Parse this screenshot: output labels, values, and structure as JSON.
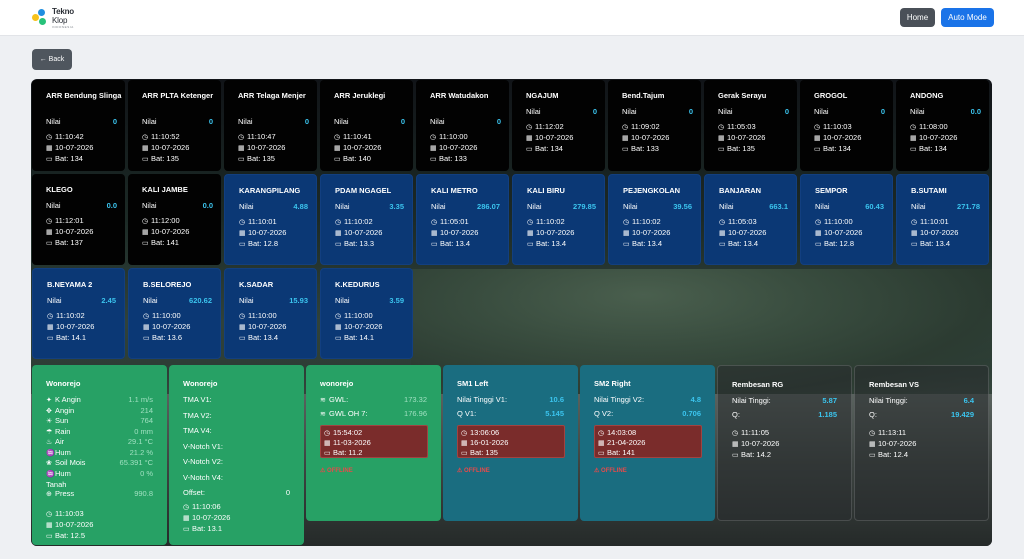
{
  "header": {
    "logo_line1": "Tekno",
    "logo_line2": "Klop",
    "logo_sub": "INDONESIA",
    "home_label": "Home",
    "auto_label": "Auto Mode"
  },
  "back_label": "← Back",
  "stations": [
    {
      "name": "ARR Bendung Slinga",
      "label": "Nilai",
      "value": "0",
      "time": "11:10:42",
      "date": "10-07-2026",
      "bat": "Bat: 134"
    },
    {
      "name": "ARR PLTA Ketenger",
      "label": "Nilai",
      "value": "0",
      "time": "11:10:52",
      "date": "10-07-2026",
      "bat": "Bat: 135"
    },
    {
      "name": "ARR Telaga Menjer",
      "label": "Nilai",
      "value": "0",
      "time": "11:10:47",
      "date": "10-07-2026",
      "bat": "Bat: 135"
    },
    {
      "name": "ARR Jeruklegi",
      "label": "Nilai",
      "value": "0",
      "time": "11:10:41",
      "date": "10-07-2026",
      "bat": "Bat: 140"
    },
    {
      "name": "ARR Watudakon",
      "label": "Nilai",
      "value": "0",
      "time": "11:10:00",
      "date": "10-07-2026",
      "bat": "Bat: 133"
    },
    {
      "name": "NGAJUM",
      "label": "Nilai",
      "value": "0",
      "time": "11:12:02",
      "date": "10-07-2026",
      "bat": "Bat: 134"
    },
    {
      "name": "Bend.Tajum",
      "label": "Nilai",
      "value": "0",
      "time": "11:09:02",
      "date": "10-07-2026",
      "bat": "Bat: 133"
    },
    {
      "name": "Gerak Serayu",
      "label": "Nilai",
      "value": "0",
      "time": "11:05:03",
      "date": "10-07-2026",
      "bat": "Bat: 135"
    },
    {
      "name": "GROGOL",
      "label": "Nilai",
      "value": "0",
      "time": "11:10:03",
      "date": "10-07-2026",
      "bat": "Bat: 134"
    },
    {
      "name": "ANDONG",
      "label": "Nilai",
      "value": "0.0",
      "time": "11:08:00",
      "date": "10-07-2026",
      "bat": "Bat: 134"
    },
    {
      "name": "KLEGO",
      "label": "Nilai",
      "value": "0.0",
      "time": "11:12:01",
      "date": "10-07-2026",
      "bat": "Bat: 137"
    },
    {
      "name": "KALI JAMBE",
      "label": "Nilai",
      "value": "0.0",
      "time": "11:12:00",
      "date": "10-07-2026",
      "bat": "Bat: 141"
    },
    {
      "name": "KARANGPILANG",
      "label": "Nilai",
      "value": "4.88",
      "time": "11:10:01",
      "date": "10-07-2026",
      "bat": "Bat: 12.8"
    },
    {
      "name": "PDAM NGAGEL",
      "label": "Nilai",
      "value": "3.35",
      "time": "11:10:02",
      "date": "10-07-2026",
      "bat": "Bat: 13.3"
    },
    {
      "name": "KALI METRO",
      "label": "Nilai",
      "value": "286.07",
      "time": "11:05:01",
      "date": "10-07-2026",
      "bat": "Bat: 13.4"
    },
    {
      "name": "KALI BIRU",
      "label": "Nilai",
      "value": "279.85",
      "time": "11:10:02",
      "date": "10-07-2026",
      "bat": "Bat: 13.4"
    },
    {
      "name": "PEJENGKOLAN",
      "label": "Nilai",
      "value": "39.56",
      "time": "11:10:02",
      "date": "10-07-2026",
      "bat": "Bat: 13.4"
    },
    {
      "name": "BANJARAN",
      "label": "Nilai",
      "value": "663.1",
      "time": "11:05:03",
      "date": "10-07-2026",
      "bat": "Bat: 13.4"
    },
    {
      "name": "SEMPOR",
      "label": "Nilai",
      "value": "60.43",
      "time": "11:10:00",
      "date": "10-07-2026",
      "bat": "Bat: 12.8"
    },
    {
      "name": "B.SUTAMI",
      "label": "Nilai",
      "value": "271.78",
      "time": "11:10:01",
      "date": "10-07-2026",
      "bat": "Bat: 13.4"
    },
    {
      "name": "B.NEYAMA 2",
      "label": "Nilai",
      "value": "2.45",
      "time": "11:10:02",
      "date": "10-07-2026",
      "bat": "Bat: 14.1"
    },
    {
      "name": "B.SELOREJO",
      "label": "Nilai",
      "value": "620.62",
      "time": "11:10:00",
      "date": "10-07-2026",
      "bat": "Bat: 13.6"
    },
    {
      "name": "K.SADAR",
      "label": "Nilai",
      "value": "15.93",
      "time": "11:10:00",
      "date": "10-07-2026",
      "bat": "Bat: 13.4"
    },
    {
      "name": "K.KEDURUS",
      "label": "Nilai",
      "value": "3.59",
      "time": "11:10:00",
      "date": "10-07-2026",
      "bat": "Bat: 14.1"
    }
  ],
  "weather": {
    "name": "Wonorejo",
    "rows": [
      {
        "label": "K Angin",
        "value": "1.1 m/s"
      },
      {
        "label": "Angin",
        "value": "214"
      },
      {
        "label": "Sun",
        "value": "764"
      },
      {
        "label": "Rain",
        "value": "0 mm"
      },
      {
        "label": "Air",
        "value": "29.1 °C"
      },
      {
        "label": "Hum",
        "value": "21.2 %"
      },
      {
        "label": "Soil Mois",
        "value": "65.391 °C"
      },
      {
        "label": "Hum Tanah",
        "value": "0 %"
      },
      {
        "label": "Press",
        "value": "990.8"
      }
    ],
    "time": "11:10:03",
    "date": "10-07-2026",
    "bat": "Bat: 12.5"
  },
  "tma": {
    "name": "Wonorejo",
    "rows": [
      {
        "label": "TMA V1:",
        "value": ""
      },
      {
        "label": "TMA V2:",
        "value": ""
      },
      {
        "label": "TMA V4:",
        "value": ""
      },
      {
        "label": "V-Notch V1:",
        "value": ""
      },
      {
        "label": "V-Notch V2:",
        "value": ""
      },
      {
        "label": "V-Notch V4:",
        "value": ""
      },
      {
        "label": "Offset:",
        "value": "0"
      }
    ],
    "time": "11:10:06",
    "date": "10-07-2026",
    "bat": "Bat: 13.1"
  },
  "gwl": {
    "name": "wonorejo",
    "gwl_label": "GWL:",
    "gwl_value": "173.32",
    "oh_label": "GWL OH 7:",
    "oh_value": "176.96",
    "time": "15:54:02",
    "date": "11-03-2026",
    "bat": "Bat: 11.2",
    "status": "OFFLINE"
  },
  "sm1": {
    "name": "SM1 Left",
    "r1_label": "Nilai Tinggi V1:",
    "r1_value": "10.6",
    "r2_label": "Q V1:",
    "r2_value": "5.145",
    "time": "13:06:06",
    "date": "16-01-2026",
    "bat": "Bat: 135",
    "status": "OFFLINE"
  },
  "sm2": {
    "name": "SM2 Right",
    "r1_label": "Nilai Tinggi V2:",
    "r1_value": "4.8",
    "r2_label": "Q V2:",
    "r2_value": "0.706",
    "time": "14:03:08",
    "date": "21-04-2026",
    "bat": "Bat: 141",
    "status": "OFFLINE"
  },
  "rg": {
    "name": "Rembesan RG",
    "r1_label": "Nilai Tinggi:",
    "r1_value": "5.87",
    "r2_label": "Q:",
    "r2_value": "1.185",
    "time": "11:11:05",
    "date": "10-07-2026",
    "bat": "Bat: 14.2"
  },
  "vs": {
    "name": "Rembesan VS",
    "r1_label": "Nilai Tinggi:",
    "r1_value": "6.4",
    "r2_label": "Q:",
    "r2_value": "19.429",
    "time": "11:13:11",
    "date": "10-07-2026",
    "bat": "Bat: 12.4"
  }
}
